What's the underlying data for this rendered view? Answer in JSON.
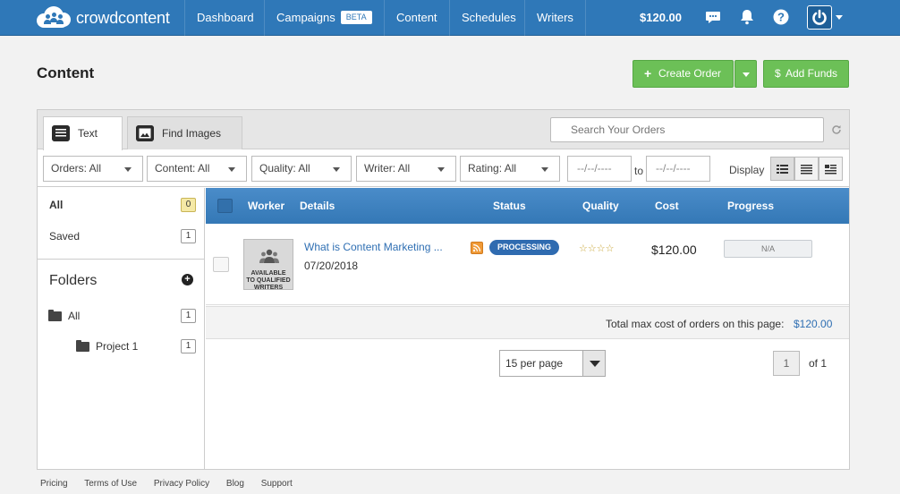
{
  "brand": {
    "name": "crowdcontent"
  },
  "nav": {
    "items": [
      {
        "label": "Dashboard"
      },
      {
        "label": "Campaigns",
        "badge": "BETA"
      },
      {
        "label": "Content"
      },
      {
        "label": "Schedules"
      },
      {
        "label": "Writers"
      }
    ],
    "balance": "$120.00",
    "icons": [
      "chat-icon",
      "bell-icon",
      "help-icon",
      "power-icon"
    ]
  },
  "page": {
    "title": "Content",
    "create_order": "Create Order",
    "add_funds": "Add Funds"
  },
  "tabs": [
    {
      "label": "Text",
      "icon": "text-doc-icon",
      "active": true
    },
    {
      "label": "Find Images",
      "icon": "image-icon",
      "active": false
    }
  ],
  "search": {
    "placeholder": "Search Your Orders"
  },
  "filters": {
    "orders": "Orders: All",
    "content": "Content: All",
    "quality": "Quality: All",
    "writer": "Writer: All",
    "rating": "Rating: All",
    "date_from": "--/--/----",
    "to_label": "to",
    "date_to": "--/--/----",
    "display_label": "Display"
  },
  "sidebar": {
    "items": [
      {
        "label": "All",
        "count": "0"
      },
      {
        "label": "Saved",
        "count": "1"
      }
    ],
    "folders_title": "Folders",
    "folders": [
      {
        "label": "All",
        "count": "1"
      },
      {
        "label": "Project 1",
        "count": "1"
      }
    ]
  },
  "table": {
    "headers": {
      "worker": "Worker",
      "details": "Details",
      "status": "Status",
      "quality": "Quality",
      "cost": "Cost",
      "progress": "Progress"
    },
    "rows": [
      {
        "worker_label_1": "AVAILABLE",
        "worker_label_2": "TO QUALIFIED",
        "worker_label_3": "WRITERS",
        "title": "What is Content Marketing ...",
        "date": "07/20/2018",
        "status": "PROCESSING",
        "rating_stars": 4,
        "stars": "☆☆☆☆",
        "cost": "$120.00",
        "progress": "N/A"
      }
    ],
    "total_label": "Total max cost of orders on this page:",
    "total_value": "$120.00"
  },
  "pagination": {
    "per_page": "15 per page",
    "current_page": "1",
    "of_label": "of 1"
  },
  "footer": {
    "links": [
      "Pricing",
      "Terms of Use",
      "Privacy Policy",
      "Blog",
      "Support"
    ]
  },
  "colors": {
    "nav_bg": "#2f78b8",
    "button_green": "#6cc057",
    "status_blue": "#2f6bb0",
    "link_blue": "#2f6fb3"
  }
}
